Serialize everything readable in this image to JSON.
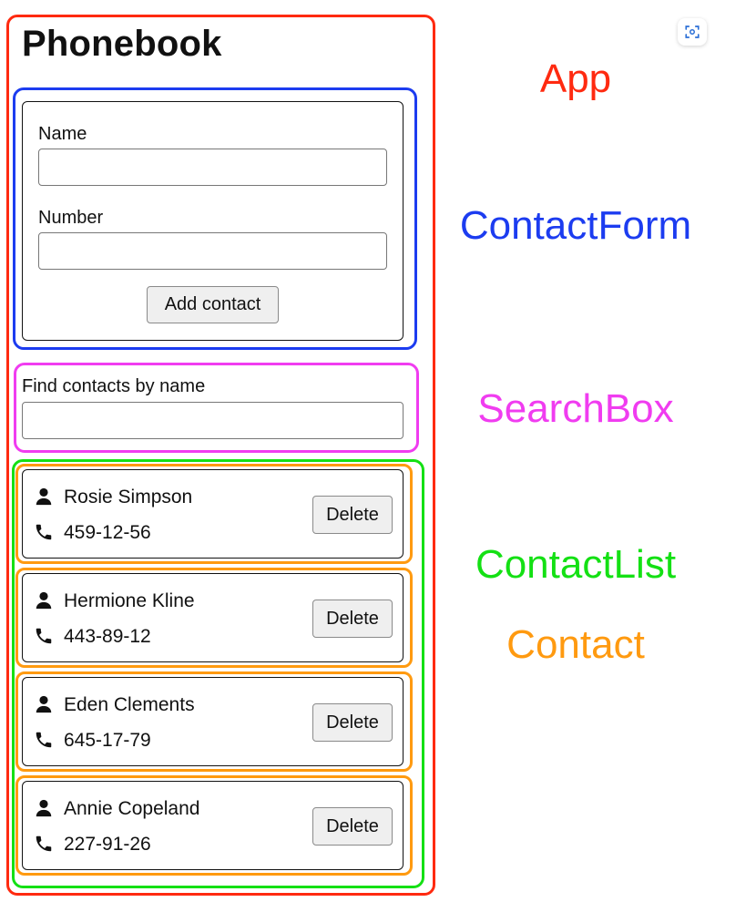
{
  "app": {
    "title": "Phonebook"
  },
  "contact_form": {
    "name_label": "Name",
    "name_value": "",
    "number_label": "Number",
    "number_value": "",
    "add_button_label": "Add contact"
  },
  "search_box": {
    "label": "Find contacts by name",
    "value": ""
  },
  "contacts": [
    {
      "name": "Rosie Simpson",
      "number": "459-12-56",
      "delete_label": "Delete"
    },
    {
      "name": "Hermione Kline",
      "number": "443-89-12",
      "delete_label": "Delete"
    },
    {
      "name": "Eden Clements",
      "number": "645-17-79",
      "delete_label": "Delete"
    },
    {
      "name": "Annie Copeland",
      "number": "227-91-26",
      "delete_label": "Delete"
    }
  ],
  "annotations": {
    "app": {
      "text": "App",
      "color": "#ff2a10"
    },
    "contact_form": {
      "text": "ContactForm",
      "color": "#1c3cf0"
    },
    "search_box": {
      "text": "SearchBox",
      "color": "#f03cf0"
    },
    "contact_list": {
      "text": "ContactList",
      "color": "#14e014"
    },
    "contact": {
      "text": "Contact",
      "color": "#ff9a10"
    }
  },
  "icons": {
    "person": "person-icon",
    "phone": "phone-icon",
    "scan": "scan-text-icon"
  }
}
